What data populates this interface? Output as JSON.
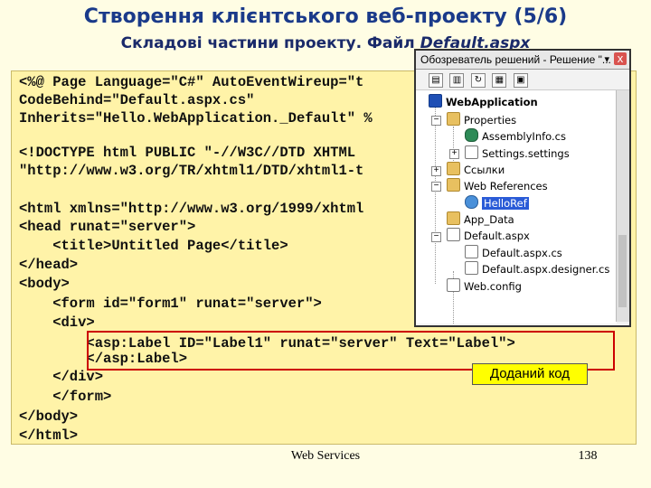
{
  "slide": {
    "title": "Створення клієнтського веб-проекту (5/6)",
    "subtitle_prefix": "Складові частини проекту. Файл ",
    "subtitle_file": "Default.aspx",
    "added_code_label": "Доданий код",
    "footer_center": "Web Services",
    "footer_page": "138"
  },
  "code": {
    "line1": "<%@ Page Language=\"C#\" AutoEventWireup=\"t",
    "line2": "CodeBehind=\"Default.aspx.cs\"",
    "line3": "Inherits=\"Hello.WebApplication._Default\" %",
    "line4": "<!DOCTYPE html PUBLIC \"-//W3C//DTD XHTML",
    "line5": "\"http://www.w3.org/TR/xhtml1/DTD/xhtml1-t",
    "line6": "<html xmlns=\"http://www.w3.org/1999/xhtml",
    "line7": "<head runat=\"server\">",
    "line8": "    <title>Untitled Page</title>",
    "line9": "</head>",
    "line10": "<body>",
    "line11": "    <form id=\"form1\" runat=\"server\">",
    "line12": "    <div>",
    "line13": "        <asp:Label ID=\"Label1\" runat=\"server\" Text=\"Label\">",
    "line14": "        </asp:Label>",
    "line15": "    </div>",
    "line16": "    </form>",
    "line17": "</body>",
    "line18": "</html>"
  },
  "explorer": {
    "title": "Обозреватель решений - Решение \"...",
    "menu": "▾ ",
    "close": "x",
    "nodes": {
      "root": "WebApplication",
      "properties": "Properties",
      "assemblyinfo": "AssemblyInfo.cs",
      "settings": "Settings.settings",
      "refs": "Ссылки",
      "webrefs": "Web References",
      "helloref": "HelloRef",
      "appdata": "App_Data",
      "default_aspx": "Default.aspx",
      "default_cs": "Default.aspx.cs",
      "default_designer": "Default.aspx.designer.cs",
      "webconfig": "Web.config"
    }
  },
  "colors": {
    "background": "#fffde4",
    "code_bg": "#fff3a8",
    "title": "#1a3a8a",
    "highlight": "#cc0000",
    "selection": "#2a5bd7"
  }
}
